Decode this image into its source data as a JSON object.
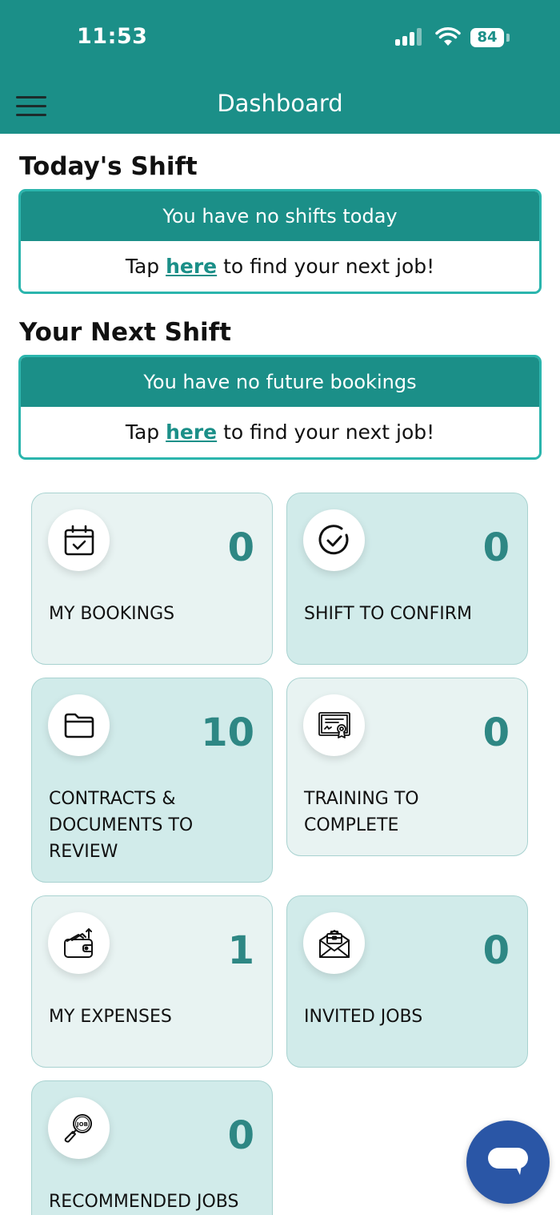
{
  "status_bar": {
    "time": "11:53",
    "battery": "84"
  },
  "header": {
    "title": "Dashboard",
    "menu_icon": "hamburger-menu-icon"
  },
  "today_shift": {
    "title": "Today's Shift",
    "banner": "You have no shifts today",
    "tap_prefix": "Tap ",
    "link": "here",
    "tap_suffix": " to find your next job!"
  },
  "next_shift": {
    "title": "Your Next Shift",
    "banner": "You have no future bookings",
    "tap_prefix": "Tap ",
    "link": "here",
    "tap_suffix": " to find your next job!"
  },
  "tiles": [
    {
      "label": "MY BOOKINGS",
      "count": "0",
      "icon": "calendar-check-icon"
    },
    {
      "label": "SHIFT TO CONFIRM",
      "count": "0",
      "icon": "circle-check-icon"
    },
    {
      "label": "CONTRACTS & DOCUMENTS TO REVIEW",
      "count": "10",
      "icon": "folder-icon"
    },
    {
      "label": "TRAINING TO COMPLETE",
      "count": "0",
      "icon": "certificate-icon"
    },
    {
      "label": "MY EXPENSES",
      "count": "1",
      "icon": "wallet-icon"
    },
    {
      "label": "INVITED JOBS",
      "count": "0",
      "icon": "envelope-briefcase-icon"
    },
    {
      "label": "RECOMMENDED JOBS",
      "count": "0",
      "icon": "job-search-icon"
    }
  ],
  "colors": {
    "brand_teal": "#1b8f88",
    "card_border": "#2bb5ad",
    "tile_light": "#e8f3f2",
    "tile_dark": "#d1ebea",
    "count_text": "#2e8784",
    "chat_button": "#2a56a6"
  },
  "chat_button_icon": "chat-bubble-icon"
}
